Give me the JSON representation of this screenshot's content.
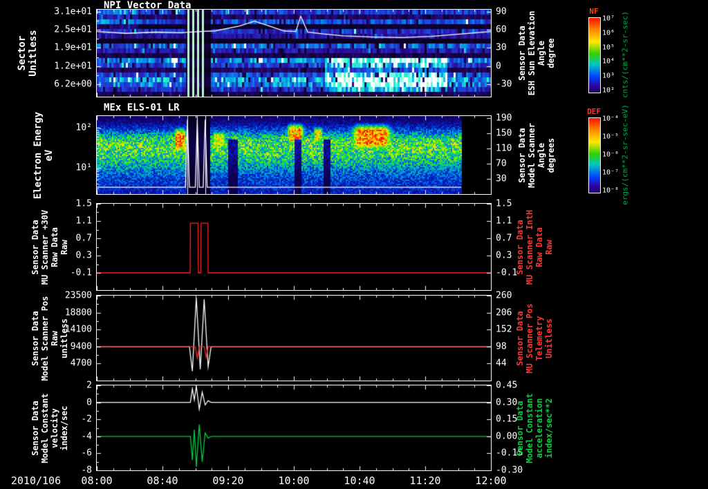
{
  "page": {
    "bg": "#000000",
    "date_label": "2010/106"
  },
  "x_axis": {
    "tick_labels": [
      "08:00",
      "08:40",
      "09:20",
      "10:00",
      "10:40",
      "11:20",
      "12:00"
    ],
    "start_hour": 8,
    "end_hour": 12
  },
  "chart_data": [
    {
      "type": "heatmap",
      "name": "npi-vector-data",
      "title": "NPI Vector Data",
      "left_axis": {
        "label_lines": [
          "Sector",
          "Unitless"
        ],
        "ticks": [
          "3.1e+01",
          "2.5e+01",
          "1.9e+01",
          "1.2e+01",
          "6.2e+00"
        ],
        "color": "#ffffff"
      },
      "right_axis": {
        "label_lines": [
          "Sensor Data",
          "ESH Sun Elevation",
          "Angle",
          "degree"
        ],
        "ticks": [
          "90",
          "60",
          "30",
          "0",
          "-30"
        ],
        "color": "#ffffff"
      },
      "colorbar": {
        "title": "NF",
        "title_color": "#ff4400",
        "units": "cnts/(cm**2-sr-sec)",
        "units_color": "#00a84c",
        "tick_labels": [
          "10⁷",
          "10⁶",
          "10⁵",
          "10⁴",
          "10³",
          "10²"
        ]
      },
      "overlay": {
        "name": "sun-elevation-angle",
        "color": "#ffffff",
        "axis": "right",
        "points": [
          [
            8.0,
            57
          ],
          [
            8.3,
            54
          ],
          [
            8.6,
            56
          ],
          [
            8.85,
            55
          ],
          [
            9.05,
            57
          ],
          [
            9.2,
            58
          ],
          [
            9.45,
            66
          ],
          [
            9.6,
            74
          ],
          [
            9.75,
            66
          ],
          [
            9.9,
            58
          ],
          [
            10.02,
            57
          ],
          [
            10.07,
            82
          ],
          [
            10.14,
            56
          ],
          [
            10.3,
            53
          ],
          [
            10.5,
            50
          ],
          [
            10.8,
            48
          ],
          [
            11.1,
            47
          ],
          [
            11.4,
            49
          ],
          [
            11.7,
            53
          ],
          [
            12.0,
            57
          ]
        ]
      },
      "heatmap": {
        "row_profile": [
          0.45,
          0.2,
          0.5,
          0.07,
          0.4,
          0.3,
          0.06,
          0.55,
          0.35,
          0.15,
          0.6,
          0.45,
          0.2,
          0.5,
          0.68,
          0.6,
          0.4,
          0.15
        ],
        "bright_patches": [
          {
            "t": [
              10.3,
              11.55
            ],
            "rows": [
              10,
              16
            ],
            "boost": 0.35
          },
          {
            "t": [
              8.0,
              8.4
            ],
            "rows": [
              0,
              3
            ],
            "boost": 0.15
          }
        ],
        "event": {
          "t": [
            8.9,
            9.15
          ],
          "lines": [
            8.92,
            8.97,
            9.02,
            9.07
          ]
        }
      }
    },
    {
      "type": "heatmap",
      "name": "els-spectrogram",
      "title": "MEx ELS-01 LR",
      "left_axis": {
        "label_lines": [
          "Electron Energy",
          "eV"
        ],
        "ticks": [
          "10²",
          "10¹"
        ],
        "color": "#ffffff"
      },
      "right_axis": {
        "label_lines": [
          "Sensor Data",
          "Model Scanner",
          "Angle",
          "degrees"
        ],
        "ticks": [
          "190",
          "150",
          "110",
          "70",
          "30"
        ],
        "color": "#ffffff"
      },
      "colorbar": {
        "title": "DEF",
        "title_color": "#ff3333",
        "units": "ergs/(cm**2-sr-sec-eV)",
        "units_color": "#00a84c",
        "tick_labels": [
          "10⁻⁴",
          "10⁻⁵",
          "10⁻⁶",
          "10⁻⁷",
          "10⁻⁸"
        ]
      },
      "overlay": {
        "name": "model-scanner-angle",
        "color": "#ffffff",
        "axis": "right",
        "points": [
          [
            8.0,
            8
          ],
          [
            8.9,
            8
          ],
          [
            8.92,
            186
          ],
          [
            8.94,
            8
          ],
          [
            9.0,
            8
          ],
          [
            9.02,
            186
          ],
          [
            9.04,
            8
          ],
          [
            9.08,
            8
          ],
          [
            9.1,
            186
          ],
          [
            9.12,
            8
          ],
          [
            11.7,
            8
          ]
        ]
      },
      "heatmap": {
        "data_t_end": 11.7,
        "profile": [
          [
            0,
            0.1
          ],
          [
            0.08,
            0.16
          ],
          [
            0.18,
            0.3
          ],
          [
            0.28,
            0.52
          ],
          [
            0.38,
            0.58
          ],
          [
            0.48,
            0.55
          ],
          [
            0.58,
            0.47
          ],
          [
            0.68,
            0.36
          ],
          [
            0.8,
            0.28
          ],
          [
            1,
            0.2
          ]
        ],
        "blobs": [
          {
            "t": [
              8.76,
              8.92
            ],
            "y": [
              0.1,
              0.5
            ],
            "v": 0.95
          },
          {
            "t": [
              9.15,
              9.32
            ],
            "y": [
              0.15,
              0.45
            ],
            "v": 0.78
          },
          {
            "t": [
              9.9,
              10.12
            ],
            "y": [
              0.05,
              0.4
            ],
            "v": 0.9
          },
          {
            "t": [
              10.18,
              10.3
            ],
            "y": [
              0.1,
              0.38
            ],
            "v": 0.82
          },
          {
            "t": [
              10.52,
              11.05
            ],
            "y": [
              0.05,
              0.48
            ],
            "v": 0.97
          }
        ],
        "dark_columns": [
          {
            "t": [
              9.33,
              9.42
            ]
          },
          {
            "t": [
              10.0,
              10.07
            ]
          },
          {
            "t": [
              10.3,
              10.37
            ]
          }
        ],
        "event": {
          "t": [
            8.9,
            9.15
          ],
          "lines": [
            8.92,
            9.02,
            9.1
          ]
        }
      }
    },
    {
      "type": "line",
      "name": "mu-scanner-30v",
      "left_axis": {
        "label_lines": [
          "Sensor Data",
          "MU Scanner +30V",
          "Raw Data",
          "Raw"
        ],
        "ticks": [
          "1.5",
          "1.1",
          "0.7",
          "0.3",
          "-0.1"
        ],
        "color": "#ffffff"
      },
      "right_axis": {
        "label_lines": [
          "Sensor Data",
          "MU Scanner IntH",
          "Raw Data",
          "Raw"
        ],
        "ticks": [
          "1.5",
          "1.1",
          "0.7",
          "0.3",
          "-0.1"
        ],
        "color": "#ff3333"
      },
      "y_range": [
        -0.5,
        1.5
      ],
      "series": [
        {
          "name": "mu-scanner-inth-raw",
          "color": "#ff2222",
          "points": [
            [
              8.0,
              -0.1
            ],
            [
              8.948,
              -0.1
            ],
            [
              8.95,
              1.05
            ],
            [
              9.028,
              1.05
            ],
            [
              9.03,
              -0.1
            ],
            [
              9.055,
              -0.1
            ],
            [
              9.058,
              1.05
            ],
            [
              9.128,
              1.05
            ],
            [
              9.13,
              -0.1
            ],
            [
              12.0,
              -0.1
            ]
          ]
        }
      ]
    },
    {
      "type": "line",
      "name": "scanner-position",
      "left_axis": {
        "label_lines": [
          "Sensor Data",
          "Model Scanner Pos",
          "Raw",
          "unitless"
        ],
        "ticks": [
          "23500",
          "18800",
          "14100",
          "9400",
          "4700"
        ],
        "color": "#ffffff"
      },
      "right_axis": {
        "label_lines": [
          "Sensor Data",
          "MU Scanner Pos",
          "Telemetry",
          "Unitless"
        ],
        "ticks": [
          "260",
          "206",
          "152",
          "98",
          "44"
        ],
        "color": "#ff3333"
      },
      "y_range": [
        0,
        23500
      ],
      "series": [
        {
          "name": "model-scanner-pos-raw",
          "color": "#ffffff",
          "points": [
            [
              8.0,
              9400
            ],
            [
              8.94,
              9400
            ],
            [
              8.97,
              2600
            ],
            [
              9.01,
              22900
            ],
            [
              9.05,
              3100
            ],
            [
              9.09,
              22500
            ],
            [
              9.13,
              3800
            ],
            [
              9.16,
              9400
            ],
            [
              12.0,
              9400
            ]
          ]
        },
        {
          "name": "mu-scanner-pos-telemetry",
          "color": "#ff2222",
          "points": [
            [
              8.0,
              9400
            ],
            [
              9.0,
              9400
            ],
            [
              9.02,
              6200
            ],
            [
              9.04,
              9400
            ],
            [
              9.09,
              9400
            ],
            [
              9.11,
              6500
            ],
            [
              9.13,
              9400
            ],
            [
              12.0,
              9400
            ]
          ]
        }
      ]
    },
    {
      "type": "line",
      "name": "model-constant",
      "left_axis": {
        "label_lines": [
          "Sensor Data",
          "Model Constant",
          "velocity",
          "index/sec"
        ],
        "ticks": [
          "2",
          "0",
          "-2",
          "-4",
          "-6",
          "-8"
        ],
        "color": "#ffffff"
      },
      "right_axis": {
        "label_lines": [
          "Sensor Data",
          "Model Constant",
          "acceleration",
          "index/sec**2"
        ],
        "ticks": [
          "0.45",
          "0.30",
          "0.15",
          "0.00",
          "-0.15",
          "-0.30"
        ],
        "color": "#00d040"
      },
      "y_range": [
        -8,
        2
      ],
      "series": [
        {
          "name": "model-constant-velocity",
          "color": "#ffffff",
          "points": [
            [
              8.0,
              0
            ],
            [
              8.95,
              0
            ],
            [
              8.97,
              1.6
            ],
            [
              8.99,
              0.3
            ],
            [
              9.01,
              1.9
            ],
            [
              9.04,
              -0.8
            ],
            [
              9.07,
              1.2
            ],
            [
              9.1,
              -0.3
            ],
            [
              9.13,
              0.2
            ],
            [
              9.16,
              0
            ],
            [
              12.0,
              0
            ]
          ]
        },
        {
          "name": "model-constant-acceleration",
          "color": "#00d040",
          "points": [
            [
              8.0,
              -4
            ],
            [
              8.95,
              -4
            ],
            [
              8.97,
              -6.8
            ],
            [
              8.99,
              -3.2
            ],
            [
              9.01,
              -7.6
            ],
            [
              9.04,
              -2.6
            ],
            [
              9.07,
              -7.0
            ],
            [
              9.1,
              -3.6
            ],
            [
              9.13,
              -4.2
            ],
            [
              9.16,
              -4
            ],
            [
              12.0,
              -4
            ]
          ]
        }
      ]
    }
  ]
}
